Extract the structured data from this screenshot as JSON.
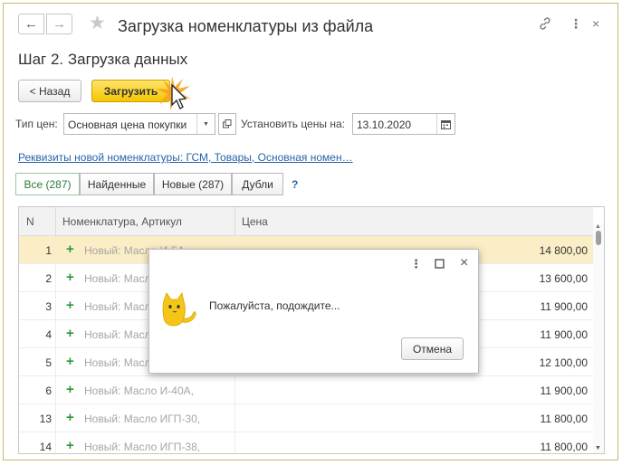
{
  "window": {
    "title": "Загрузка номенклатуры из файла",
    "link_icon": "link-icon",
    "more_icon": "more-vertical-icon",
    "close_icon": "close-icon"
  },
  "step_title": "Шаг 2. Загрузка данных",
  "toolbar": {
    "back_label": "< Назад",
    "load_label": "Загрузить"
  },
  "price_type": {
    "label": "Тип цен:",
    "value": "Основная цена покупки"
  },
  "set_prices": {
    "label": "Установить цены на:",
    "value": "13.10.2020"
  },
  "requisites_link": "Реквизиты новой номенклатуры: ГСМ, Товары, Основная номен…",
  "filters": [
    {
      "label": "Все (287)",
      "active": true
    },
    {
      "label": "Найденные",
      "active": false
    },
    {
      "label": "Новые (287)",
      "active": false
    },
    {
      "label": "Дубли",
      "active": false
    }
  ],
  "help_label": "?",
  "table": {
    "columns": {
      "n": "N",
      "name": "Номенклатура, Артикул",
      "price": "Цена"
    },
    "rows": [
      {
        "n": "1",
        "name": "Новый: Масло И-5А,",
        "price": "14 800,00"
      },
      {
        "n": "2",
        "name": "Новый: Масло",
        "price": "13 600,00"
      },
      {
        "n": "3",
        "name": "Новый: Масло",
        "price": "11 900,00"
      },
      {
        "n": "4",
        "name": "Новый: Масло",
        "price": "11 900,00"
      },
      {
        "n": "5",
        "name": "Новый: Масло",
        "price": "12 100,00"
      },
      {
        "n": "6",
        "name": "Новый: Масло И-40А,",
        "price": "11 900,00"
      },
      {
        "n": "13",
        "name": "Новый: Масло ИГП-30,",
        "price": "11 800,00"
      },
      {
        "n": "14",
        "name": "Новый: Масло ИГП-38,",
        "price": "11 800,00"
      }
    ]
  },
  "dialog": {
    "message": "Пожалуйста, подождите...",
    "cancel_label": "Отмена"
  },
  "colors": {
    "accent_yellow": "#f4c500",
    "selected_row": "#fbeec6",
    "link_blue": "#2764a8",
    "plus_green": "#2c9a3a"
  }
}
